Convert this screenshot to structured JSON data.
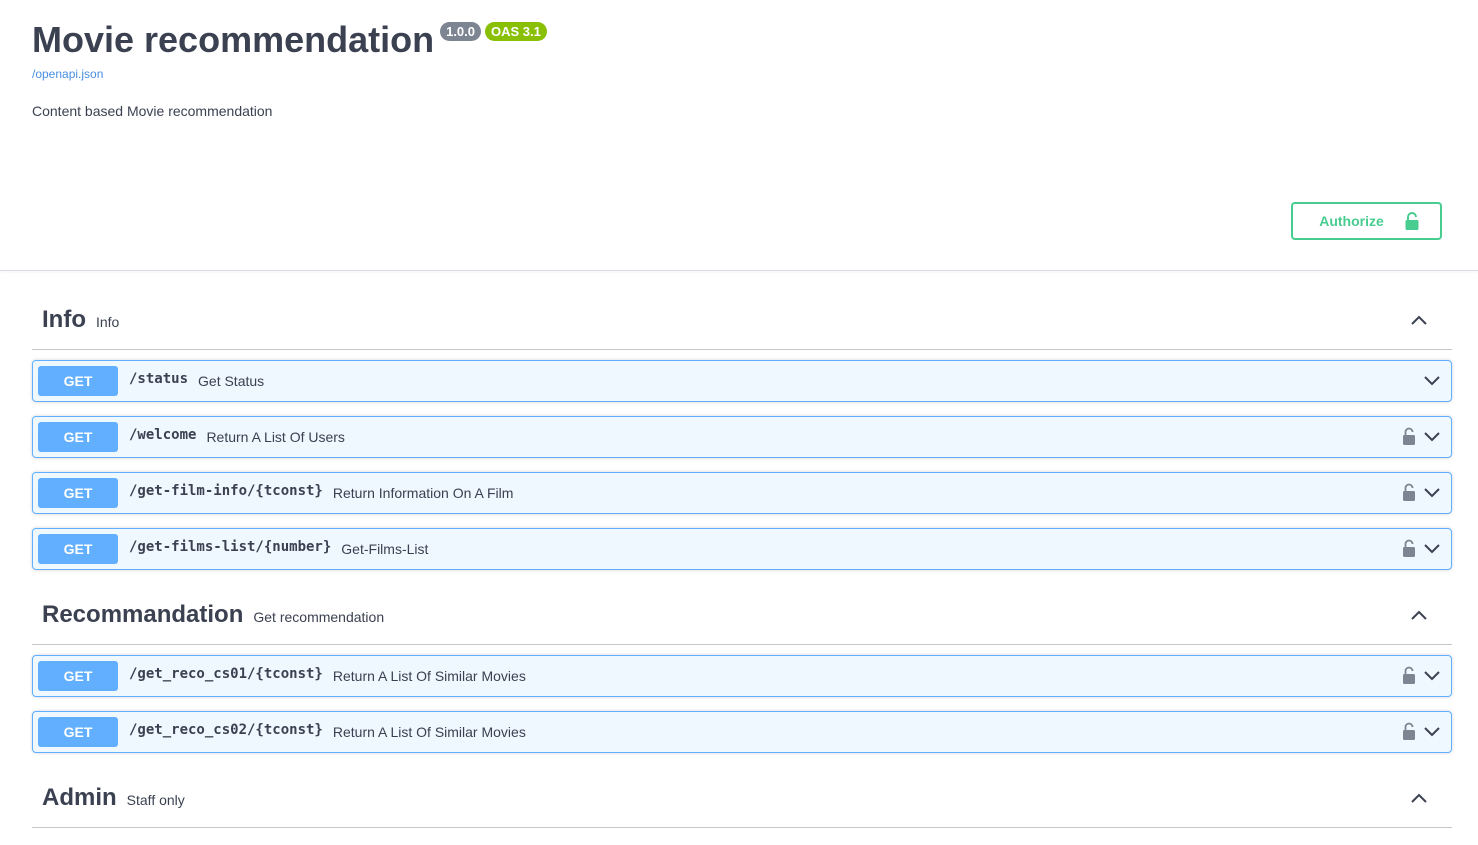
{
  "info": {
    "title": "Movie recommendation",
    "version": "1.0.0",
    "oas": "OAS 3.1",
    "spec_link": "/openapi.json",
    "description": "Content based Movie recommendation"
  },
  "authorize": {
    "label": "Authorize",
    "icon": "unlock-icon"
  },
  "colors": {
    "get": "#61affe",
    "authorize": "#49cc90",
    "version_badge": "#7d8492",
    "oas_badge": "#89bf04",
    "link": "#4990e2"
  },
  "tags": [
    {
      "name": "Info",
      "description": "Info",
      "operations": [
        {
          "method": "GET",
          "path": "/status",
          "summary": "Get Status",
          "locked": false
        },
        {
          "method": "GET",
          "path": "/welcome",
          "summary": "Return A List Of Users",
          "locked": true
        },
        {
          "method": "GET",
          "path": "/get-film-info/{tconst}",
          "summary": "Return Information On A Film",
          "locked": true
        },
        {
          "method": "GET",
          "path": "/get-films-list/{number}",
          "summary": "Get-Films-List",
          "locked": true
        }
      ]
    },
    {
      "name": "Recommandation",
      "description": "Get recommendation",
      "operations": [
        {
          "method": "GET",
          "path": "/get_reco_cs01/{tconst}",
          "summary": "Return A List Of Similar Movies",
          "locked": true
        },
        {
          "method": "GET",
          "path": "/get_reco_cs02/{tconst}",
          "summary": "Return A List Of Similar Movies",
          "locked": true
        }
      ]
    },
    {
      "name": "Admin",
      "description": "Staff only",
      "operations": []
    }
  ]
}
